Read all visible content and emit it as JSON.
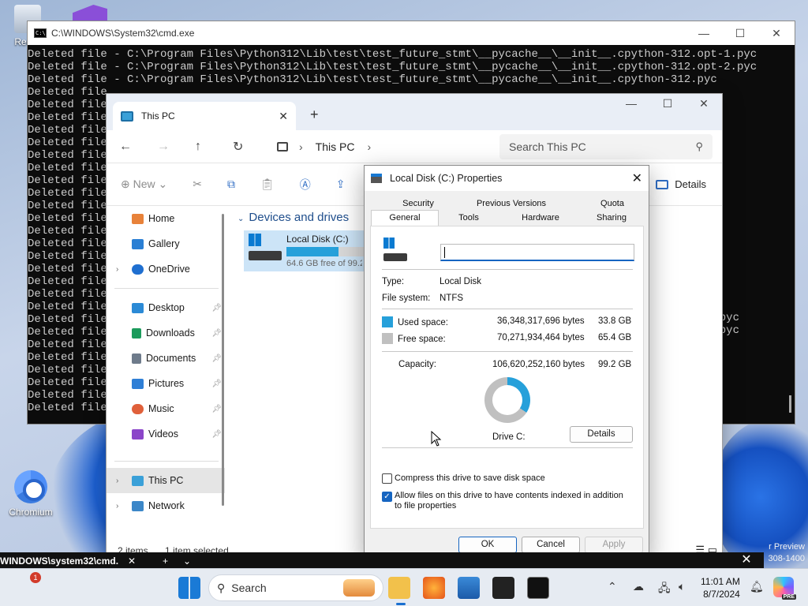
{
  "desktop": {
    "recycle_label": "Recyc",
    "chromium_label": "Chromium",
    "watermark_line1": "r Preview",
    "watermark_line2": "308-1400"
  },
  "cmd": {
    "title": "C:\\WINDOWS\\System32\\cmd.exe",
    "lines": [
      "Deleted file - C:\\Program Files\\Python312\\Lib\\test\\test_future_stmt\\__pycache__\\__init__.cpython-312.opt-1.pyc",
      "Deleted file - C:\\Program Files\\Python312\\Lib\\test\\test_future_stmt\\__pycache__\\__init__.cpython-312.opt-2.pyc",
      "Deleted file - C:\\Program Files\\Python312\\Lib\\test\\test_future_stmt\\__pycache__\\__init__.cpython-312.pyc",
      "Deleted file",
      "Deleted file",
      "Deleted file",
      "Deleted file",
      "Deleted file",
      "Deleted file",
      "Deleted file",
      "Deleted file",
      "Deleted file",
      "Deleted file",
      "Deleted file",
      "Deleted file",
      "Deleted file",
      "Deleted file",
      "Deleted file",
      "Deleted file",
      "Deleted file",
      "Deleted file",
      "Deleted file",
      "Deleted file",
      "Deleted file",
      "Deleted file",
      "Deleted file",
      "Deleted file",
      "Deleted file",
      "Deleted file"
    ],
    "right_fragments": [
      "pyc",
      "pyc",
      "pyc"
    ]
  },
  "cmd_strip": {
    "label": "WINDOWS\\system32\\cmd.",
    "close": "✕",
    "plus": "+",
    "chevron": "⌄",
    "x": "✕"
  },
  "explorer": {
    "tab_title": "This PC",
    "breadcrumb": "This PC",
    "search_placeholder": "Search This PC",
    "toolbar": {
      "new_label": "New",
      "details_label": "Details"
    },
    "sidebar": [
      {
        "label": "Home",
        "icon": "home-icon",
        "pinned": false
      },
      {
        "label": "Gallery",
        "icon": "gallery-icon",
        "pinned": false
      },
      {
        "label": "OneDrive",
        "icon": "cloud-icon",
        "pinned": false,
        "expandable": true
      },
      {
        "label": "Desktop",
        "icon": "desktop-icon",
        "pinned": true
      },
      {
        "label": "Downloads",
        "icon": "download-icon",
        "pinned": true
      },
      {
        "label": "Documents",
        "icon": "document-icon",
        "pinned": true
      },
      {
        "label": "Pictures",
        "icon": "pictures-icon",
        "pinned": true
      },
      {
        "label": "Music",
        "icon": "music-icon",
        "pinned": true
      },
      {
        "label": "Videos",
        "icon": "videos-icon",
        "pinned": true
      },
      {
        "label": "This PC",
        "icon": "pc-icon",
        "selected": true,
        "expandable": true
      },
      {
        "label": "Network",
        "icon": "network-icon",
        "expandable": true
      }
    ],
    "group_header": "Devices and drives",
    "drive": {
      "name": "Local Disk (C:)",
      "free_text": "64.6 GB free of 99.2",
      "used_fraction": 0.66
    },
    "status": {
      "items": "2 items",
      "selected": "1 item selected"
    }
  },
  "properties": {
    "title": "Local Disk (C:) Properties",
    "tabs_row1": [
      "Security",
      "Previous Versions",
      "Quota"
    ],
    "tabs_row2": [
      "General",
      "Tools",
      "Hardware",
      "Sharing"
    ],
    "active_tab": "General",
    "name_value": "",
    "type_label": "Type:",
    "type_value": "Local Disk",
    "fs_label": "File system:",
    "fs_value": "NTFS",
    "used_label": "Used space:",
    "used_bytes": "36,348,317,696 bytes",
    "used_gb": "33.8 GB",
    "free_label": "Free space:",
    "free_bytes": "70,271,934,464 bytes",
    "free_gb": "65.4 GB",
    "cap_label": "Capacity:",
    "cap_bytes": "106,620,252,160 bytes",
    "cap_gb": "99.2 GB",
    "drive_label": "Drive C:",
    "details_btn": "Details",
    "compress_label": "Compress this drive to save disk space",
    "index_label": "Allow files on this drive to have contents indexed in addition to file properties",
    "compress_checked": false,
    "index_checked": true,
    "ok": "OK",
    "cancel": "Cancel",
    "apply": "Apply",
    "colors": {
      "used": "#26a0da",
      "free": "#c0c0c0"
    },
    "used_fraction": 0.341
  },
  "taskbar": {
    "search_label": "Search",
    "alert_badge": "1",
    "time": "11:01 AM",
    "date": "8/7/2024"
  }
}
